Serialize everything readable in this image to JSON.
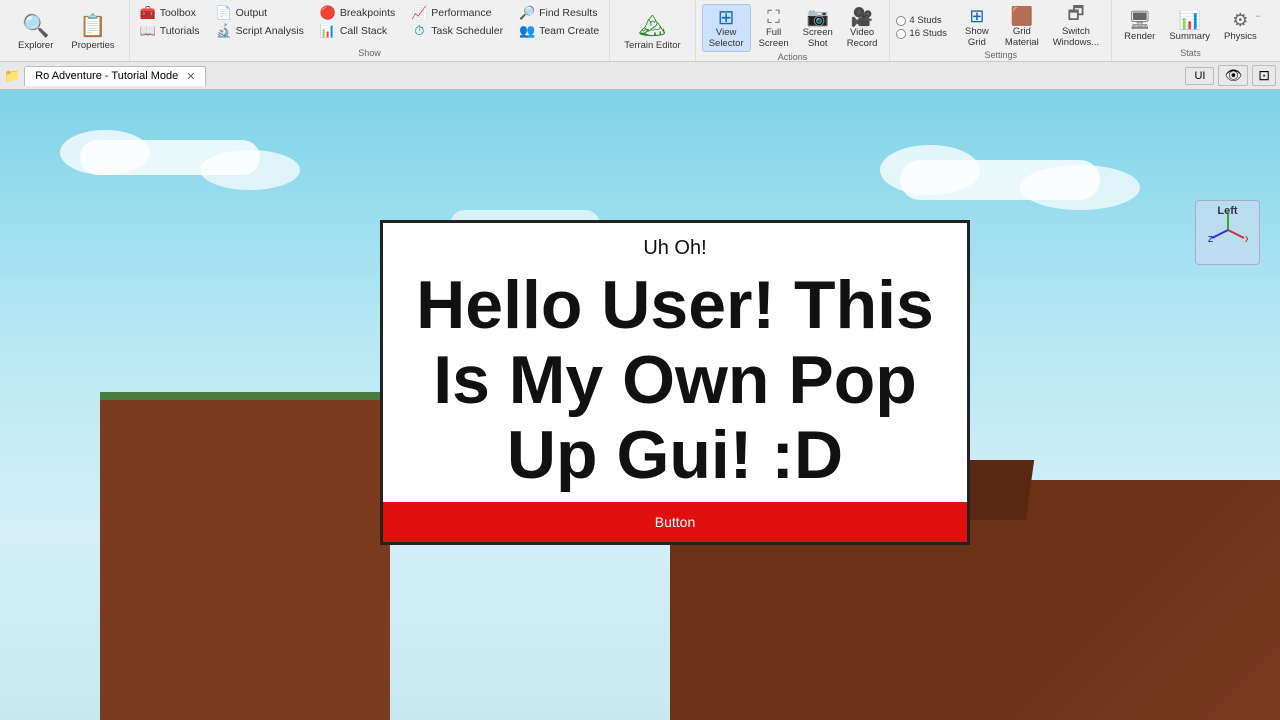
{
  "toolbar": {
    "groups": {
      "view": {
        "items": [
          {
            "id": "explorer",
            "label": "Explorer",
            "icon": "🔍"
          },
          {
            "id": "properties",
            "label": "Properties",
            "icon": "📋"
          }
        ]
      },
      "insert": {
        "label": "Show",
        "items_col1": [
          {
            "id": "toolbox",
            "label": "Toolbox",
            "icon": "🧰"
          },
          {
            "id": "tutorials",
            "label": "Tutorials",
            "icon": "📖"
          }
        ],
        "items_col2": [
          {
            "id": "output",
            "label": "Output",
            "icon": "📄"
          },
          {
            "id": "script-analysis",
            "label": "Script Analysis",
            "icon": "🔬"
          }
        ],
        "items_col3": [
          {
            "id": "breakpoints",
            "label": "Breakpoints",
            "icon": "🔴"
          },
          {
            "id": "call-stack",
            "label": "Call Stack",
            "icon": "📊"
          }
        ],
        "items_col4": [
          {
            "id": "performance",
            "label": "Performance",
            "icon": "📈"
          },
          {
            "id": "task-scheduler",
            "label": "Task Scheduler",
            "icon": "⏱"
          }
        ],
        "items_col5": [
          {
            "id": "find-results",
            "label": "Find Results",
            "icon": "🔎"
          },
          {
            "id": "team-create",
            "label": "Team Create",
            "icon": "👥"
          }
        ]
      },
      "terrain": {
        "items": [
          {
            "id": "terrain-editor",
            "label": "Terrain Editor",
            "icon": "🏔"
          }
        ]
      },
      "view_selector": {
        "label": "Actions",
        "large_items": [
          {
            "id": "view-selector",
            "label": "View\nSelector",
            "icon": "⊞"
          },
          {
            "id": "full-screen",
            "label": "Full\nScreen",
            "icon": "⛶"
          },
          {
            "id": "screen-shot",
            "label": "Screen\nShot",
            "icon": "📷"
          },
          {
            "id": "video-record",
            "label": "Video\nRecord",
            "icon": "🎥"
          }
        ]
      },
      "settings": {
        "label": "Settings",
        "radio_options": [
          "4 Studs",
          "16 Studs"
        ],
        "items": [
          {
            "id": "show-grid",
            "label": "Show\nGrid",
            "icon": "⊞"
          },
          {
            "id": "grid-material",
            "label": "Grid\nMaterial",
            "icon": "🟫"
          },
          {
            "id": "switch-windows",
            "label": "Switch\nWindows...",
            "icon": "🗗"
          }
        ]
      },
      "stats": {
        "label": "Stats",
        "items": [
          {
            "id": "render",
            "label": "Render",
            "icon": "🖥"
          },
          {
            "id": "summary",
            "label": "Summary",
            "icon": "📊"
          },
          {
            "id": "physics",
            "label": "Physics",
            "icon": "⚙"
          }
        ]
      }
    }
  },
  "tabbar": {
    "tabs": [
      {
        "id": "ro-adventure",
        "label": "Ro Adventure - Tutorial Mode",
        "closable": true
      }
    ]
  },
  "viewport": {
    "ui_buttons": [
      "UI",
      "👁",
      "🔲"
    ],
    "compass": {
      "label": "Left"
    }
  },
  "popup": {
    "title": "Uh Oh!",
    "body": "Hello User! This Is My Own Pop Up Gui! :D",
    "button_label": "Button"
  }
}
